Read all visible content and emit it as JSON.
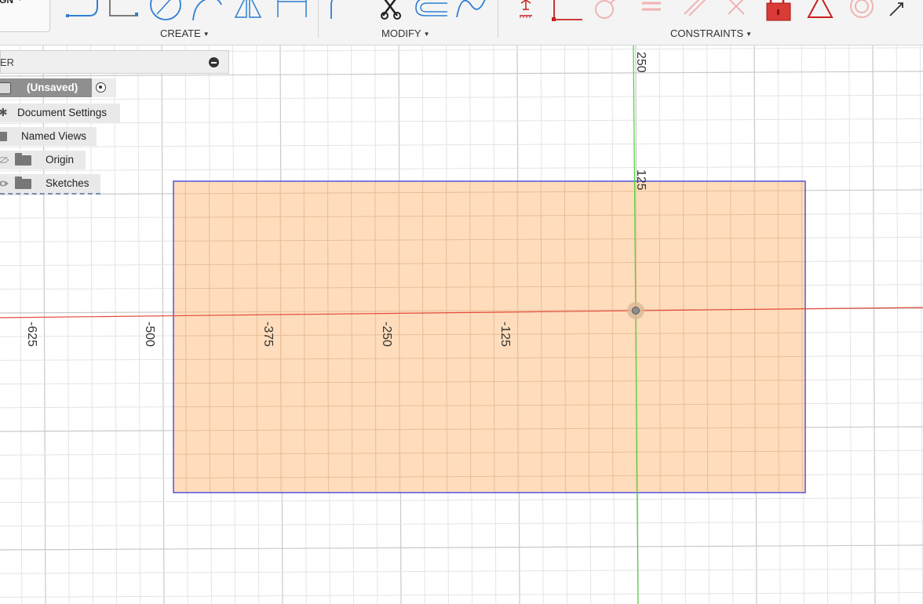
{
  "toolbar": {
    "workspace_label": "GN",
    "groups": [
      {
        "label": "CREATE"
      },
      {
        "label": "MODIFY"
      },
      {
        "label": "CONSTRAINTS"
      }
    ],
    "create_tools": [
      "line-tool-icon",
      "rectangle-tool-icon",
      "circle-tool-icon",
      "arc-tool-icon",
      "mirror-tool-icon",
      "dimension-tool-icon"
    ],
    "modify_tools": [
      "fillet-tool-icon",
      "trim-tool-icon",
      "offset-tool-icon",
      "spline-tool-icon"
    ],
    "constraint_tools": [
      "coincident-icon",
      "perpendicular-icon",
      "tangent-icon",
      "equal-icon",
      "parallel-icon",
      "collinear-icon",
      "fix-lock-icon",
      "symmetric-icon",
      "concentric-icon",
      "sketch-dimension-icon"
    ],
    "accent_color": "#c8201e"
  },
  "browser": {
    "header_title": "ER",
    "root_label": "(Unsaved)",
    "items": [
      {
        "label": "Document Settings"
      },
      {
        "label": "Named Views"
      },
      {
        "label": "Origin"
      },
      {
        "label": "Sketches"
      }
    ]
  },
  "canvas": {
    "h_labels": [
      "-625",
      "-500",
      "-375",
      "-250",
      "-125"
    ],
    "v_labels": [
      "250",
      "125"
    ],
    "x_axis_color": "#e24b3b",
    "y_axis_color": "#4ccf3a",
    "profile_fill": "#ffd7b0",
    "profile_stroke": "#3b3bdd"
  }
}
